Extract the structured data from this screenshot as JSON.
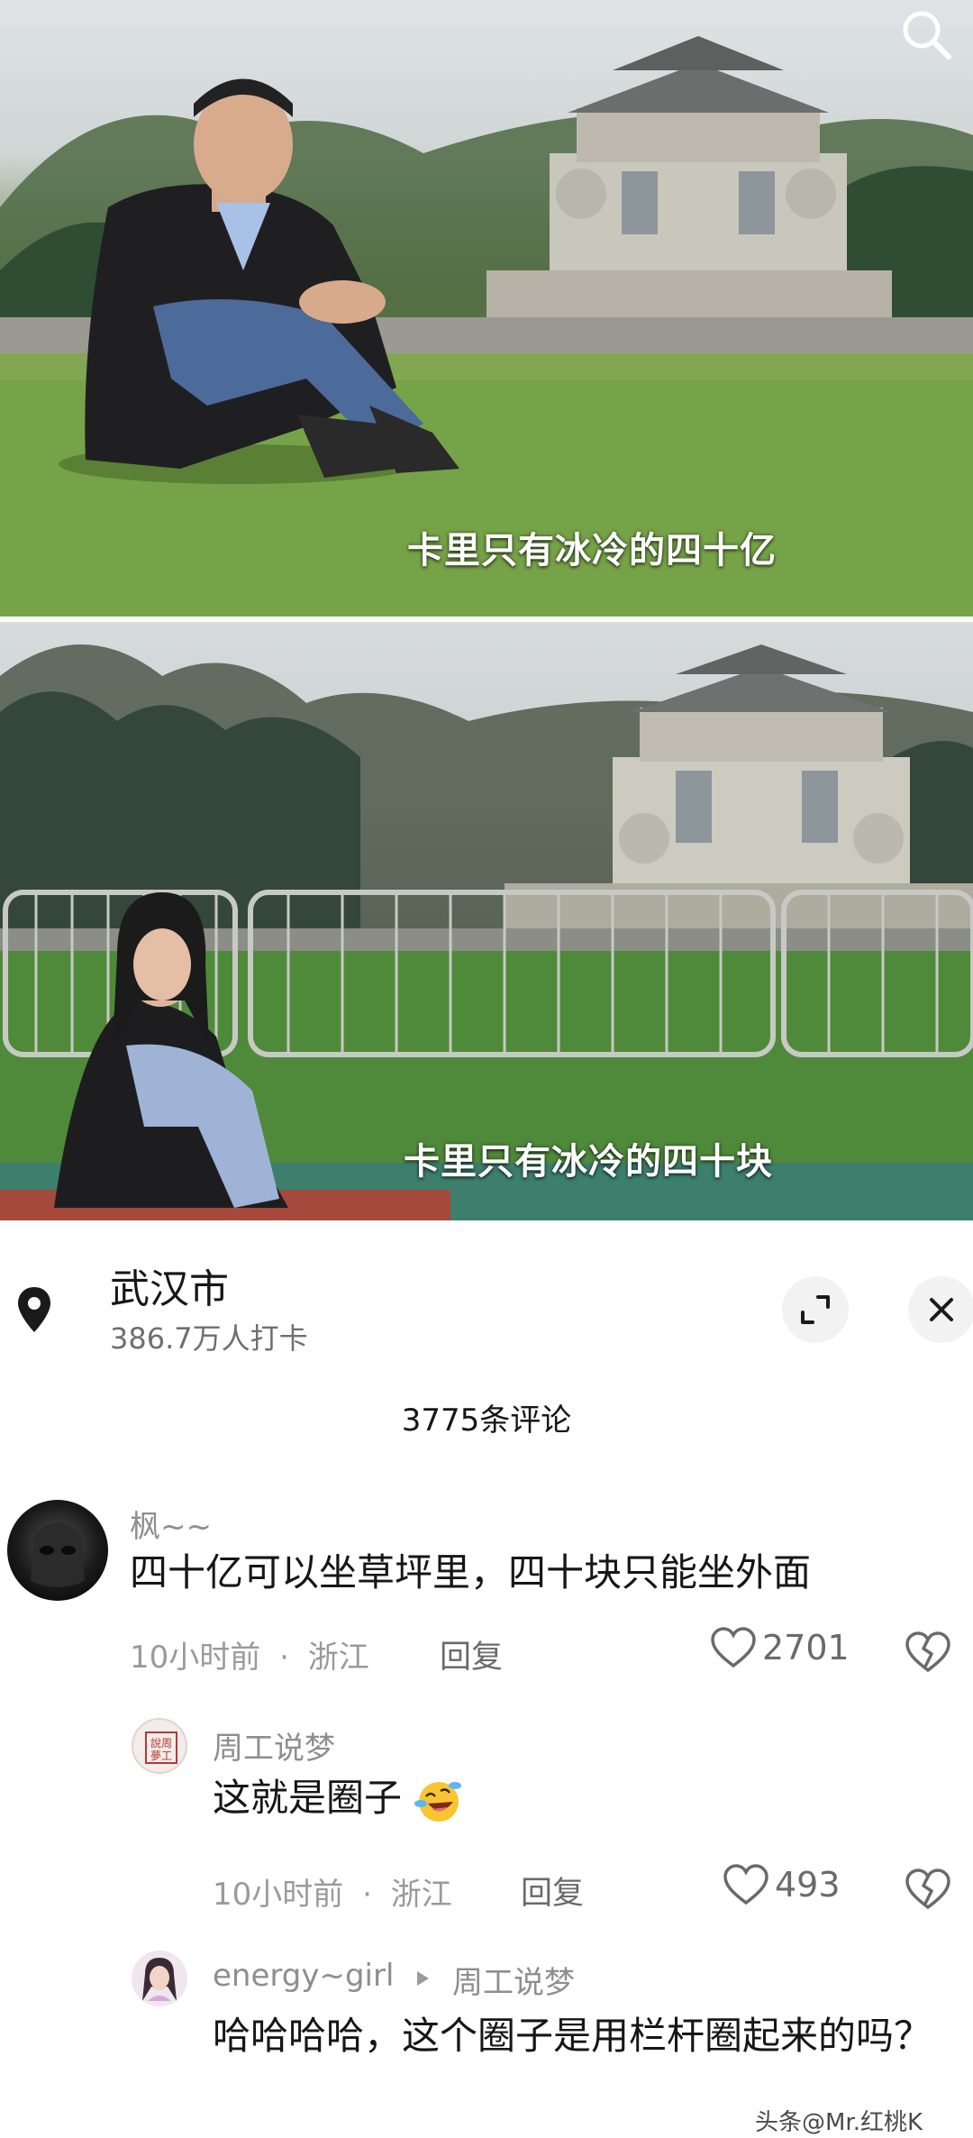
{
  "photos": {
    "top_caption": "卡里只有冰冷的四十亿",
    "bottom_caption": "卡里只有冰冷的四十块"
  },
  "location": {
    "title": "武汉市",
    "checkins": "386.7万人打卡"
  },
  "comments_header": "3775条评论",
  "comments": [
    {
      "username": "枫~~",
      "text": "四十亿可以坐草坪里，四十块只能坐外面",
      "time": "10小时前",
      "region": "浙江",
      "reply_label": "回复",
      "likes": "2701"
    },
    {
      "username": "周工说梦",
      "avatar_text": "說周 夢工",
      "text": "这就是圈子",
      "time": "10小时前",
      "region": "浙江",
      "reply_label": "回复",
      "likes": "493"
    },
    {
      "username": "energy~girl",
      "reply_to": "周工说梦",
      "text": "哈哈哈哈，这个圈子是用栏杆圈起来的吗？"
    }
  ],
  "meta_separator": "·",
  "watermark": "头条@Mr.红桃K",
  "icons": [
    "search-icon",
    "location-pin-icon",
    "expand-icon",
    "close-icon",
    "heart-icon",
    "broken-heart-icon",
    "laughing-crying-emoji",
    "reply-arrow-icon"
  ]
}
